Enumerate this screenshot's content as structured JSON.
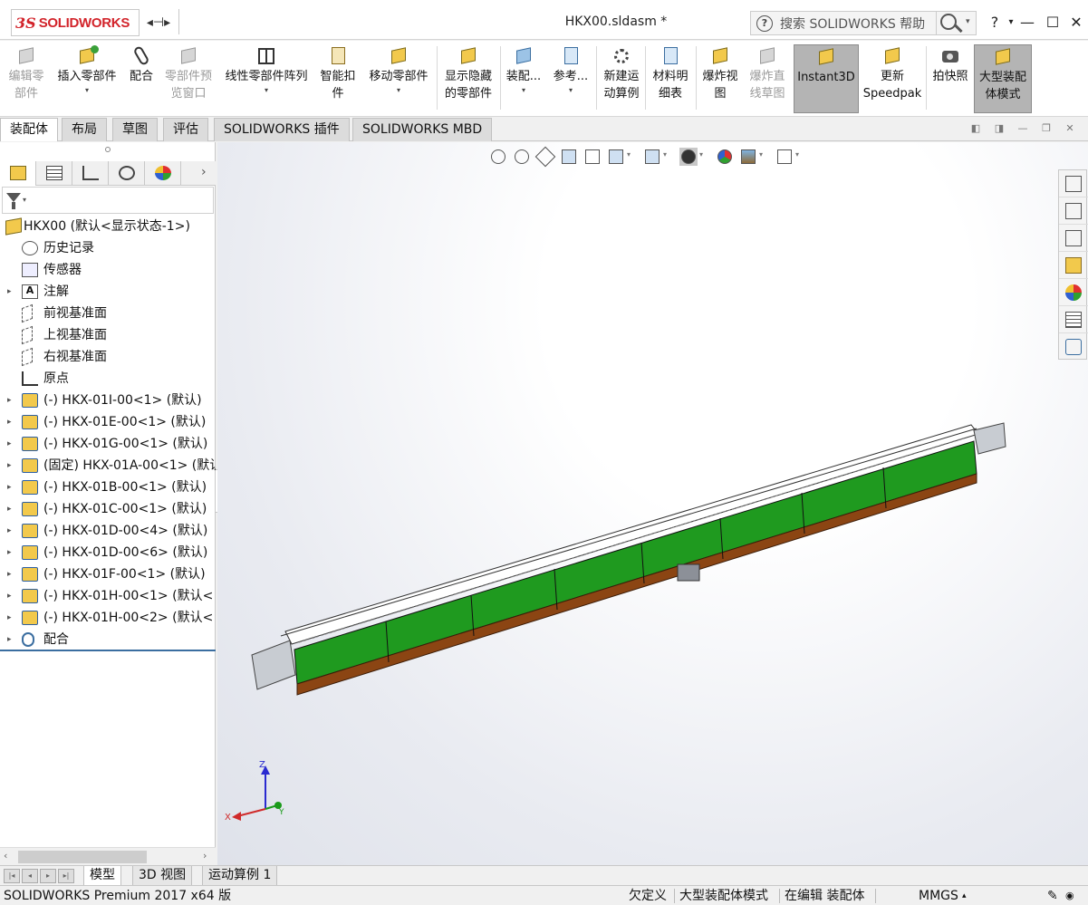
{
  "titlebar": {
    "logo_ds": "3S",
    "logo_text": "SOLIDWORKS",
    "pin_glyph": "◂⊣▸",
    "doc_title": "HKX00.sldasm *",
    "search_placeholder": "搜索 SOLIDWORKS 帮助",
    "help_glyph": "?",
    "controls": {
      "help": "?",
      "more": "▾",
      "minimize": "—",
      "maximize": "☐",
      "close": "✕"
    }
  },
  "ribbon": {
    "edit_part": [
      "编辑零",
      "部件"
    ],
    "insert_parts": "插入零部件",
    "mate": "配合",
    "preview_window": [
      "零部件预",
      "览窗口"
    ],
    "linear_pattern": "线性零部件阵列",
    "smart_fasteners": [
      "智能扣",
      "件"
    ],
    "move_component": "移动零部件",
    "show_hidden": [
      "显示隐藏",
      "的零部件"
    ],
    "assembly_features": "装配...",
    "reference": "参考...",
    "new_motion_study": [
      "新建运",
      "动算例"
    ],
    "bom": [
      "材料明",
      "细表"
    ],
    "exploded_view": [
      "爆炸视",
      "图"
    ],
    "explode_line_sketch": [
      "爆炸直",
      "线草图"
    ],
    "instant3d": "Instant3D",
    "update_speedpak": [
      "更新",
      "Speedpak"
    ],
    "snapshot": "拍快照",
    "large_assembly": [
      "大型装配",
      "体模式"
    ],
    "dropdown": "▾"
  },
  "tabs": [
    "装配体",
    "布局",
    "草图",
    "评估",
    "SOLIDWORKS 插件",
    "SOLIDWORKS MBD"
  ],
  "feature_tree": {
    "panel_tab_more": "›",
    "filter_caret": "▾",
    "root": "HKX00  (默认<显示状态-1>)",
    "items": [
      {
        "label": "历史记录",
        "icon": "history-icon",
        "expandable": false
      },
      {
        "label": "传感器",
        "icon": "sensor-icon",
        "expandable": false
      },
      {
        "label": "注解",
        "icon": "annotation-icon",
        "expandable": true
      },
      {
        "label": "前视基准面",
        "icon": "plane-icon",
        "expandable": false
      },
      {
        "label": "上视基准面",
        "icon": "plane-icon",
        "expandable": false
      },
      {
        "label": "右视基准面",
        "icon": "plane-icon",
        "expandable": false
      },
      {
        "label": "原点",
        "icon": "origin-icon",
        "expandable": false
      },
      {
        "label": "(-) HKX-01I-00<1> (默认)",
        "icon": "part-icon",
        "expandable": true
      },
      {
        "label": "(-) HKX-01E-00<1> (默认)",
        "icon": "part-icon",
        "expandable": true
      },
      {
        "label": "(-) HKX-01G-00<1> (默认)",
        "icon": "part-icon",
        "expandable": true
      },
      {
        "label": "(固定) HKX-01A-00<1> (默认",
        "icon": "part-icon",
        "expandable": true
      },
      {
        "label": "(-) HKX-01B-00<1> (默认)",
        "icon": "part-icon",
        "expandable": true
      },
      {
        "label": "(-) HKX-01C-00<1> (默认)",
        "icon": "part-icon",
        "expandable": true
      },
      {
        "label": "(-) HKX-01D-00<4> (默认)",
        "icon": "part-icon",
        "expandable": true
      },
      {
        "label": "(-) HKX-01D-00<6> (默认)",
        "icon": "part-icon",
        "expandable": true
      },
      {
        "label": "(-) HKX-01F-00<1> (默认)",
        "icon": "part-icon",
        "expandable": true
      },
      {
        "label": "(-) HKX-01H-00<1> (默认<",
        "icon": "part-icon",
        "expandable": true
      },
      {
        "label": "(-) HKX-01H-00<2> (默认<",
        "icon": "part-icon",
        "expandable": true
      },
      {
        "label": "配合",
        "icon": "mate-icon",
        "expandable": true
      }
    ],
    "expand_glyph": "▸",
    "scroll_left": "‹",
    "scroll_right": "›"
  },
  "triad": {
    "x": "X",
    "y": "Y",
    "z": "Z"
  },
  "bottom_tabs": [
    "模型",
    "3D 视图",
    "运动算例 1"
  ],
  "bottom_nav": [
    "|◂",
    "◂",
    "▸",
    "▸|"
  ],
  "statusbar": {
    "product": "SOLIDWORKS Premium 2017 x64 版",
    "definition": "欠定义",
    "mode": "大型装配体模式",
    "editing": "在编辑 装配体",
    "units": "MMGS",
    "units_caret": "▾"
  },
  "colors": {
    "brand_red": "#d2232a",
    "model_green": "#1f9a1f",
    "model_brown": "#8b4513",
    "selection_blue": "#3b6ea0"
  }
}
